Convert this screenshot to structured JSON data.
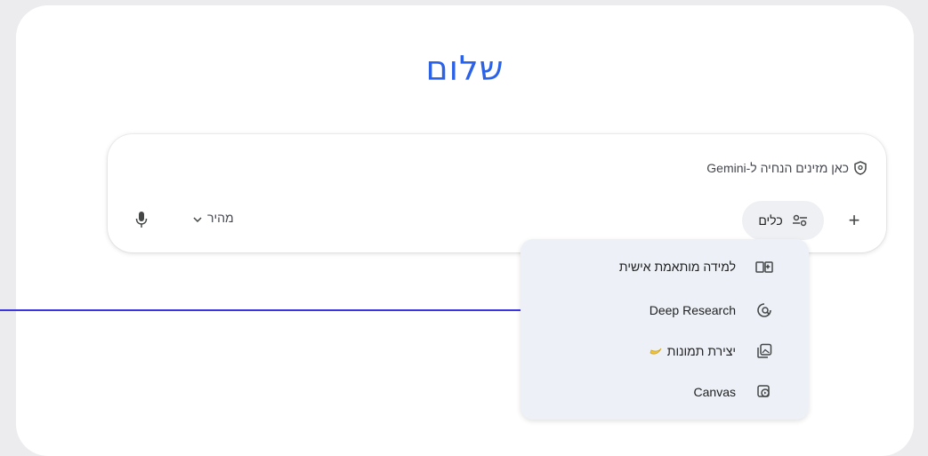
{
  "greeting": "שלום",
  "prompt": {
    "notice": "כאן מזינים הנחיה ל-Gemini",
    "tools_label": "כלים",
    "model_label": "מהיר"
  },
  "tools_menu": {
    "items": [
      {
        "label": "למידה מותאמת אישית",
        "icon": "book-sparkle-icon"
      },
      {
        "label": "Deep Research",
        "icon": "deep-research-icon"
      },
      {
        "label": "יצירת תמונות",
        "icon": "image-generation-icon",
        "badge": "banana-emoji"
      },
      {
        "label": "Canvas",
        "icon": "canvas-icon"
      }
    ]
  },
  "colors": {
    "greeting": "#2c62e8",
    "pointer_line": "#3b35e0",
    "menu_bg": "#edf1f7",
    "tools_bg": "#eef0f3"
  }
}
